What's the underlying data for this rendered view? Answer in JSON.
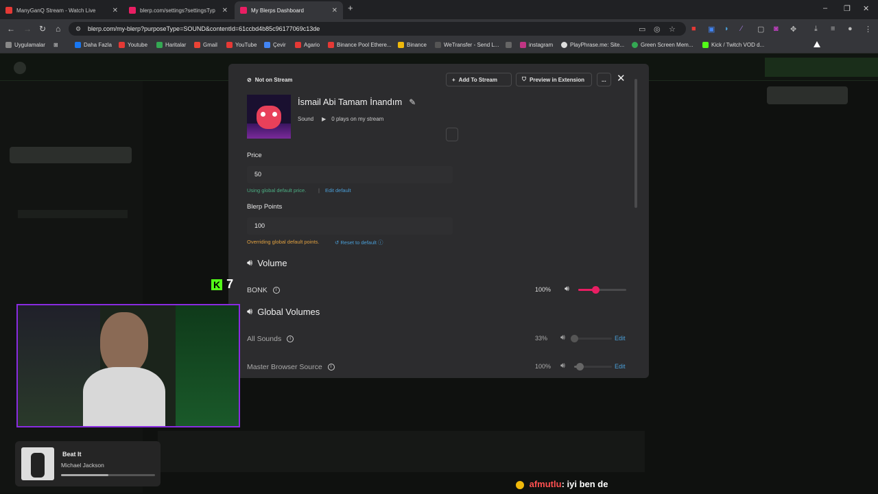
{
  "tabs": [
    {
      "label": "ManyGanQ Stream - Watch Live",
      "color": "#e53935"
    },
    {
      "label": "blerp.com/settings?settingsTyp",
      "color": "#e91e63"
    },
    {
      "label": "My Blerps Dashboard",
      "color": "#e91e63"
    }
  ],
  "tab_new": "+",
  "window_controls": [
    "–",
    "❐",
    "✕"
  ],
  "address": {
    "url": "blerp.com/my-blerp?purposeType=SOUND&contentId=61ccbd4b85c96177069c13de"
  },
  "bookmarks": [
    {
      "label": "Uygulamalar",
      "color": "#888"
    },
    {
      "label": "Daha Fazla",
      "color": "#1877f2"
    },
    {
      "label": "Youtube",
      "color": "#e53935"
    },
    {
      "label": "Haritalar",
      "color": "#34a853"
    },
    {
      "label": "Gmail",
      "color": "#ea4335"
    },
    {
      "label": "YouTube",
      "color": "#e53935"
    },
    {
      "label": "Çevir",
      "color": "#4285f4"
    },
    {
      "label": "Agario",
      "color": "#e53935"
    },
    {
      "label": "Binance Pool Ethere...",
      "color": "#e53935"
    },
    {
      "label": "Binance",
      "color": "#f0b90b"
    },
    {
      "label": "WeTransfer - Send L...",
      "color": "#555"
    },
    {
      "label": "instagram",
      "color": "#c13584"
    },
    {
      "label": "PlayPhrase.me: Site...",
      "color": "#ddd"
    },
    {
      "label": "Green Screen Mem...",
      "color": "#34a853"
    },
    {
      "label": "Kick / Twitch VOD d...",
      "color": "#53fc18"
    }
  ],
  "modal": {
    "status_badge": "Not on Stream",
    "add_to_stream": "Add To Stream",
    "preview": "Preview in Extension",
    "more": "...",
    "title": "İsmail Abi Tamam İnandım",
    "type": "Sound",
    "plays": "0 plays on my stream",
    "price_label": "Price",
    "price_value": "50",
    "price_hint": "Using global default price.",
    "price_sep": "|",
    "edit_default": "Edit default",
    "points_label": "Blerp Points",
    "points_value": "100",
    "points_hint": "Overriding global default points.",
    "reset_default": "↺ Reset to default",
    "volume_title": "Volume",
    "global_title": "Global Volumes",
    "rows": [
      {
        "name": "BONK",
        "pct": "100%",
        "level": 0.35,
        "color": "#e91e63",
        "edit": ""
      },
      {
        "name": "All Sounds",
        "pct": "33%",
        "level": 0.0,
        "color": "#555",
        "edit": "Edit"
      },
      {
        "name": "Master Browser Source",
        "pct": "100%",
        "level": 0.15,
        "color": "#666",
        "edit": "Edit"
      }
    ]
  },
  "now_playing": {
    "title": "Beat It",
    "artist": "Michael Jackson",
    "progress": 0.5
  },
  "chat": {
    "user": "afmutlu",
    "message": ": iyi ben de"
  },
  "overlay": {
    "k_count": "7"
  },
  "colors": {
    "accent": "#e91e63",
    "hint_green": "#4caf84",
    "hint_orange": "#e0a040",
    "link": "#4a9fd8"
  }
}
